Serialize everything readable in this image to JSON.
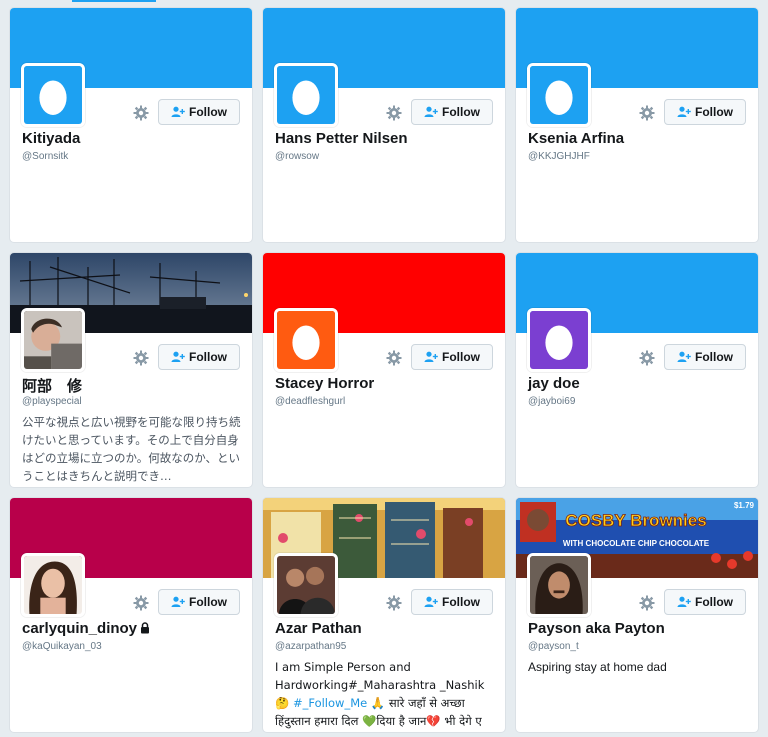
{
  "colors": {
    "accent": "#1da1f2",
    "link": "#1b95e0"
  },
  "follow_label": "Follow",
  "cards": [
    {
      "name": "Kitiyada",
      "handle": "@Sornsitk",
      "banner_color": "#1da1f2",
      "avatar": "egg-blue-icon"
    },
    {
      "name": "Hans Petter Nilsen",
      "handle": "@rowsow",
      "banner_color": "#1da1f2",
      "avatar": "egg-blue-icon"
    },
    {
      "name": "Ksenia Arfina",
      "handle": "@KKJGHJHF",
      "banner_color": "#1da1f2",
      "avatar": "egg-blue-icon"
    },
    {
      "name": "阿部　修",
      "handle": "@playspecial",
      "banner": "night-harbor-photo",
      "avatar": "profile-photo",
      "bio": "公平な視点と広い視野を可能な限り持ち続けたいと思っています。その上で自分自身はどの立場に立つのか。何故なのか、ということはきちんと説明でき…"
    },
    {
      "name": "Stacey Horror",
      "handle": "@deadfleshgurl",
      "banner_color": "#ff0000",
      "avatar": "egg-orange-icon"
    },
    {
      "name": "jay doe",
      "handle": "@jayboi69",
      "banner_color": "#1da1f2",
      "avatar": "egg-purple-icon"
    },
    {
      "name": "carlyquin_dinoy",
      "handle": "@kaQuikayan_03",
      "banner_color": "#b8004a",
      "avatar": "profile-photo",
      "protected": true
    },
    {
      "name": "Azar Pathan",
      "handle": "@azarpathan95",
      "banner": "colorful-building-photo",
      "avatar": "profile-photo",
      "bio_line1": "I am Simple Person and Hardworking#_Maharashtra _Nashik 🤔",
      "bio_tag": "#_Follow_Me",
      "bio_line2": " 🙏 सारे जहाँ से अच्छा हिंदुस्तान हमारा दिल 💚दिया है जान💔 भी देगे ए वतन…"
    },
    {
      "name": "Payson aka Payton",
      "handle": "@payson_t",
      "banner": "cosby-brownies-photo",
      "avatar": "profile-photo",
      "bio": "Aspiring stay at home dad",
      "banner_text": {
        "title": "COSBY Brownies",
        "subtitle": "WITH CHOCOLATE CHIP CHOCOLATE",
        "price": "$1.79"
      }
    }
  ]
}
